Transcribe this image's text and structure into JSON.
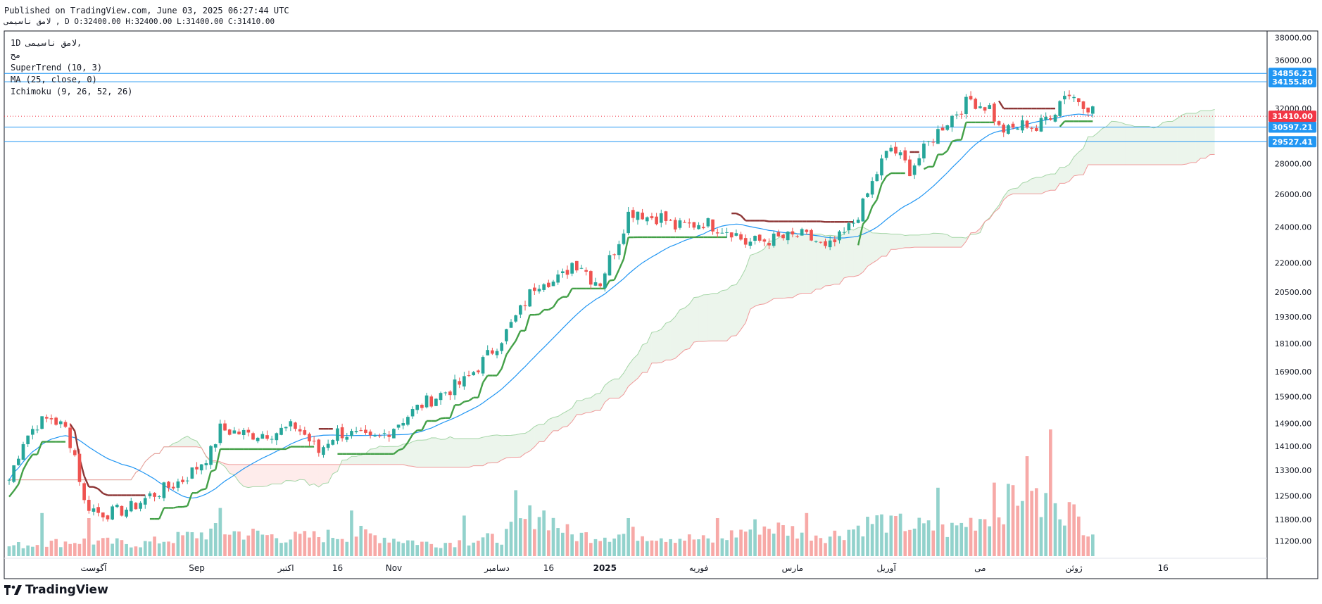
{
  "header": {
    "published": "Published on TradingView.com, June 03, 2025 06:27:44 UTC",
    "ohlc_line": "لامق ناسیمی , D O:32400.00 H:32400.00 L:31400.00 C:31410.00"
  },
  "legend": {
    "symbol_line": "1D لامق ناسیمی,",
    "exchange": "مح",
    "supertrend": "SuperTrend (10, 3)",
    "ma": "MA (25, close, 0)",
    "ichimoku": "Ichimoku (9, 26, 52, 26)"
  },
  "footer": {
    "brand": "TradingView",
    "logo_icon": "tradingview-logo-icon"
  },
  "colors": {
    "up": "#26a69a",
    "down": "#ef5350",
    "supertrend_up": "#43a047",
    "supertrend_down": "#8d3535",
    "ma": "#2196f3",
    "hline": "#2196f3",
    "price_label": "#f23645"
  },
  "chart_data": {
    "type": "candlestick",
    "symbol": "لامق ناسیمی",
    "interval": "1D",
    "ohlc_last": {
      "open": 32400.0,
      "high": 32400.0,
      "low": 31400.0,
      "close": 31410.0
    },
    "y_ticks": [
      "38000.00",
      "36000.00",
      "32000.00",
      "28000.00",
      "26000.00",
      "24000.00",
      "22000.00",
      "20500.00",
      "19300.00",
      "18100.00",
      "16900.00",
      "15900.00",
      "14900.00",
      "14100.00",
      "13300.00",
      "12500.00",
      "11800.00",
      "11200.00"
    ],
    "x_ticks": [
      "آگوست",
      "Sep",
      "اکتبر",
      "16",
      "Nov",
      "دسامبر",
      "16",
      "2025",
      "فوریه",
      "مارس",
      "آوریل",
      "می",
      "ژوئن",
      "16"
    ],
    "y_scale": "log",
    "ylim": [
      10800,
      38500
    ],
    "horizontal_lines": [
      {
        "label": "34856.21",
        "value": 34856.21
      },
      {
        "label": "34155.80",
        "value": 34155.8
      },
      {
        "label": "30597.21",
        "value": 30597.21
      },
      {
        "label": "29527.41",
        "value": 29527.41
      }
    ],
    "last_price_label": {
      "label": "31410.00",
      "value": 31410.0
    },
    "close_path": [
      [
        0,
        13000
      ],
      [
        3,
        14300
      ],
      [
        6,
        14900
      ],
      [
        9,
        15100
      ],
      [
        12,
        14700
      ],
      [
        14,
        13800
      ],
      [
        16,
        12300
      ],
      [
        19,
        12000
      ],
      [
        22,
        12000
      ],
      [
        26,
        12150
      ],
      [
        30,
        12500
      ],
      [
        33,
        12700
      ],
      [
        37,
        13000
      ],
      [
        40,
        13400
      ],
      [
        43,
        13900
      ],
      [
        45,
        14700
      ],
      [
        48,
        14600
      ],
      [
        51,
        14500
      ],
      [
        54,
        14550
      ],
      [
        57,
        14600
      ],
      [
        59,
        14700
      ],
      [
        61,
        14800
      ],
      [
        63,
        14500
      ],
      [
        66,
        13900
      ],
      [
        68,
        14300
      ],
      [
        70,
        14600
      ],
      [
        73,
        14500
      ],
      [
        75,
        14400
      ],
      [
        77,
        14300
      ],
      [
        79,
        14400
      ],
      [
        82,
        14800
      ],
      [
        85,
        15200
      ],
      [
        88,
        15600
      ],
      [
        91,
        15900
      ],
      [
        94,
        16200
      ],
      [
        97,
        16500
      ],
      [
        100,
        17100
      ],
      [
        103,
        17800
      ],
      [
        106,
        18600
      ],
      [
        109,
        19600
      ],
      [
        112,
        20800
      ],
      [
        114,
        21200
      ],
      [
        116,
        21000
      ],
      [
        118,
        21300
      ],
      [
        120,
        22000
      ],
      [
        122,
        21900
      ],
      [
        124,
        21200
      ],
      [
        126,
        21000
      ],
      [
        128,
        22200
      ],
      [
        130,
        23300
      ],
      [
        132,
        24800
      ],
      [
        134,
        25000
      ],
      [
        136,
        24600
      ],
      [
        139,
        24600
      ],
      [
        142,
        24000
      ],
      [
        145,
        24100
      ],
      [
        148,
        24300
      ],
      [
        151,
        24000
      ],
      [
        154,
        23800
      ],
      [
        157,
        23100
      ],
      [
        160,
        23200
      ],
      [
        163,
        23300
      ],
      [
        166,
        23400
      ],
      [
        169,
        23500
      ],
      [
        172,
        23200
      ],
      [
        174,
        22700
      ],
      [
        176,
        23100
      ],
      [
        178,
        23600
      ],
      [
        180,
        24300
      ],
      [
        182,
        25300
      ],
      [
        184,
        26700
      ],
      [
        186,
        28100
      ],
      [
        188,
        29100
      ],
      [
        190,
        28400
      ],
      [
        192,
        27600
      ],
      [
        194,
        28400
      ],
      [
        196,
        29400
      ],
      [
        199,
        30700
      ],
      [
        201,
        31400
      ],
      [
        203,
        32100
      ],
      [
        205,
        32700
      ],
      [
        207,
        32300
      ],
      [
        209,
        32100
      ],
      [
        211,
        30500
      ],
      [
        213,
        30300
      ],
      [
        215,
        30600
      ],
      [
        217,
        30900
      ],
      [
        219,
        30400
      ],
      [
        221,
        31300
      ],
      [
        223,
        31900
      ],
      [
        225,
        33300
      ],
      [
        227,
        32900
      ],
      [
        229,
        32500
      ],
      [
        231,
        31900
      ]
    ],
    "volume_path": [
      [
        0,
        0.1
      ],
      [
        15,
        0.15
      ],
      [
        28,
        0.12
      ],
      [
        45,
        0.25
      ],
      [
        60,
        0.18
      ],
      [
        75,
        0.22
      ],
      [
        90,
        0.12
      ],
      [
        105,
        0.18
      ],
      [
        113,
        0.45
      ],
      [
        120,
        0.2
      ],
      [
        135,
        0.22
      ],
      [
        150,
        0.15
      ],
      [
        160,
        0.3
      ],
      [
        175,
        0.2
      ],
      [
        185,
        0.35
      ],
      [
        200,
        0.25
      ],
      [
        208,
        0.4
      ],
      [
        214,
        0.55
      ],
      [
        218,
        0.8
      ],
      [
        220,
        0.35
      ],
      [
        222,
        1.0
      ],
      [
        224,
        0.5
      ],
      [
        226,
        0.45
      ],
      [
        228,
        0.35
      ],
      [
        231,
        0.28
      ]
    ],
    "volume_spikes": [
      {
        "x": 7,
        "rel": 0.34
      },
      {
        "x": 17,
        "rel": 0.3
      },
      {
        "x": 45,
        "rel": 0.38
      },
      {
        "x": 73,
        "rel": 0.36
      },
      {
        "x": 97,
        "rel": 0.32
      },
      {
        "x": 108,
        "rel": 0.52
      },
      {
        "x": 132,
        "rel": 0.3
      },
      {
        "x": 151,
        "rel": 0.3
      },
      {
        "x": 170,
        "rel": 0.34
      },
      {
        "x": 188,
        "rel": 0.32
      },
      {
        "x": 198,
        "rel": 0.54
      },
      {
        "x": 210,
        "rel": 0.58
      },
      {
        "x": 214,
        "rel": 0.56
      },
      {
        "x": 222,
        "rel": 1.0
      }
    ]
  }
}
